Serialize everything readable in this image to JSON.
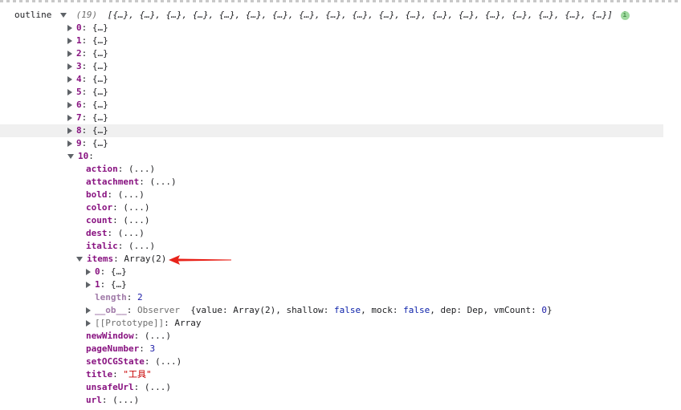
{
  "root": {
    "key": "outline",
    "count": "(19)",
    "preview": "[{…}, {…}, {…}, {…}, {…}, {…}, {…}, {…}, {…}, {…}, {…}, {…}, {…}, {…}, {…}, {…}, {…}, {…}, {…}]",
    "info_badge": "i"
  },
  "collapsed_items": [
    {
      "key": "0",
      "value": "{…}"
    },
    {
      "key": "1",
      "value": "{…}"
    },
    {
      "key": "2",
      "value": "{…}"
    },
    {
      "key": "3",
      "value": "{…}"
    },
    {
      "key": "4",
      "value": "{…}"
    },
    {
      "key": "5",
      "value": "{…}"
    },
    {
      "key": "6",
      "value": "{…}"
    },
    {
      "key": "7",
      "value": "{…}"
    },
    {
      "key": "8",
      "value": "{…}"
    },
    {
      "key": "9",
      "value": "{…}"
    }
  ],
  "expanded_item": {
    "key": "10"
  },
  "props_before": [
    {
      "key": "action",
      "value": "(...)"
    },
    {
      "key": "attachment",
      "value": "(...)"
    },
    {
      "key": "bold",
      "value": "(...)"
    },
    {
      "key": "color",
      "value": "(...)"
    },
    {
      "key": "count",
      "value": "(...)"
    },
    {
      "key": "dest",
      "value": "(...)"
    },
    {
      "key": "italic",
      "value": "(...)"
    }
  ],
  "items_prop": {
    "key": "items",
    "value": "Array(2)",
    "children": [
      {
        "key": "0",
        "value": "{…}"
      },
      {
        "key": "1",
        "value": "{…}"
      }
    ],
    "length_key": "length",
    "length_value": "2",
    "ob": {
      "key": "__ob__",
      "class": "Observer",
      "open": "{value: Array(2), shallow: ",
      "shallow": "false",
      "mid1": ", mock: ",
      "mock": "false",
      "mid2": ", dep: Dep, vmCount: ",
      "vmCount": "0",
      "close": "}"
    },
    "proto": {
      "key": "[[Prototype]]",
      "value": "Array"
    }
  },
  "props_after": {
    "newWindow": "(...)",
    "pageNumber": "3",
    "setOCGState": "(...)",
    "title": "\"工具\"",
    "unsafeUrl": "(...)",
    "url": "(...)"
  },
  "colors": {
    "key": "#881280",
    "number": "#1a1aa6",
    "string": "#c80000",
    "keyword": "#0d22aa",
    "annotation_arrow": "#e8231a"
  }
}
